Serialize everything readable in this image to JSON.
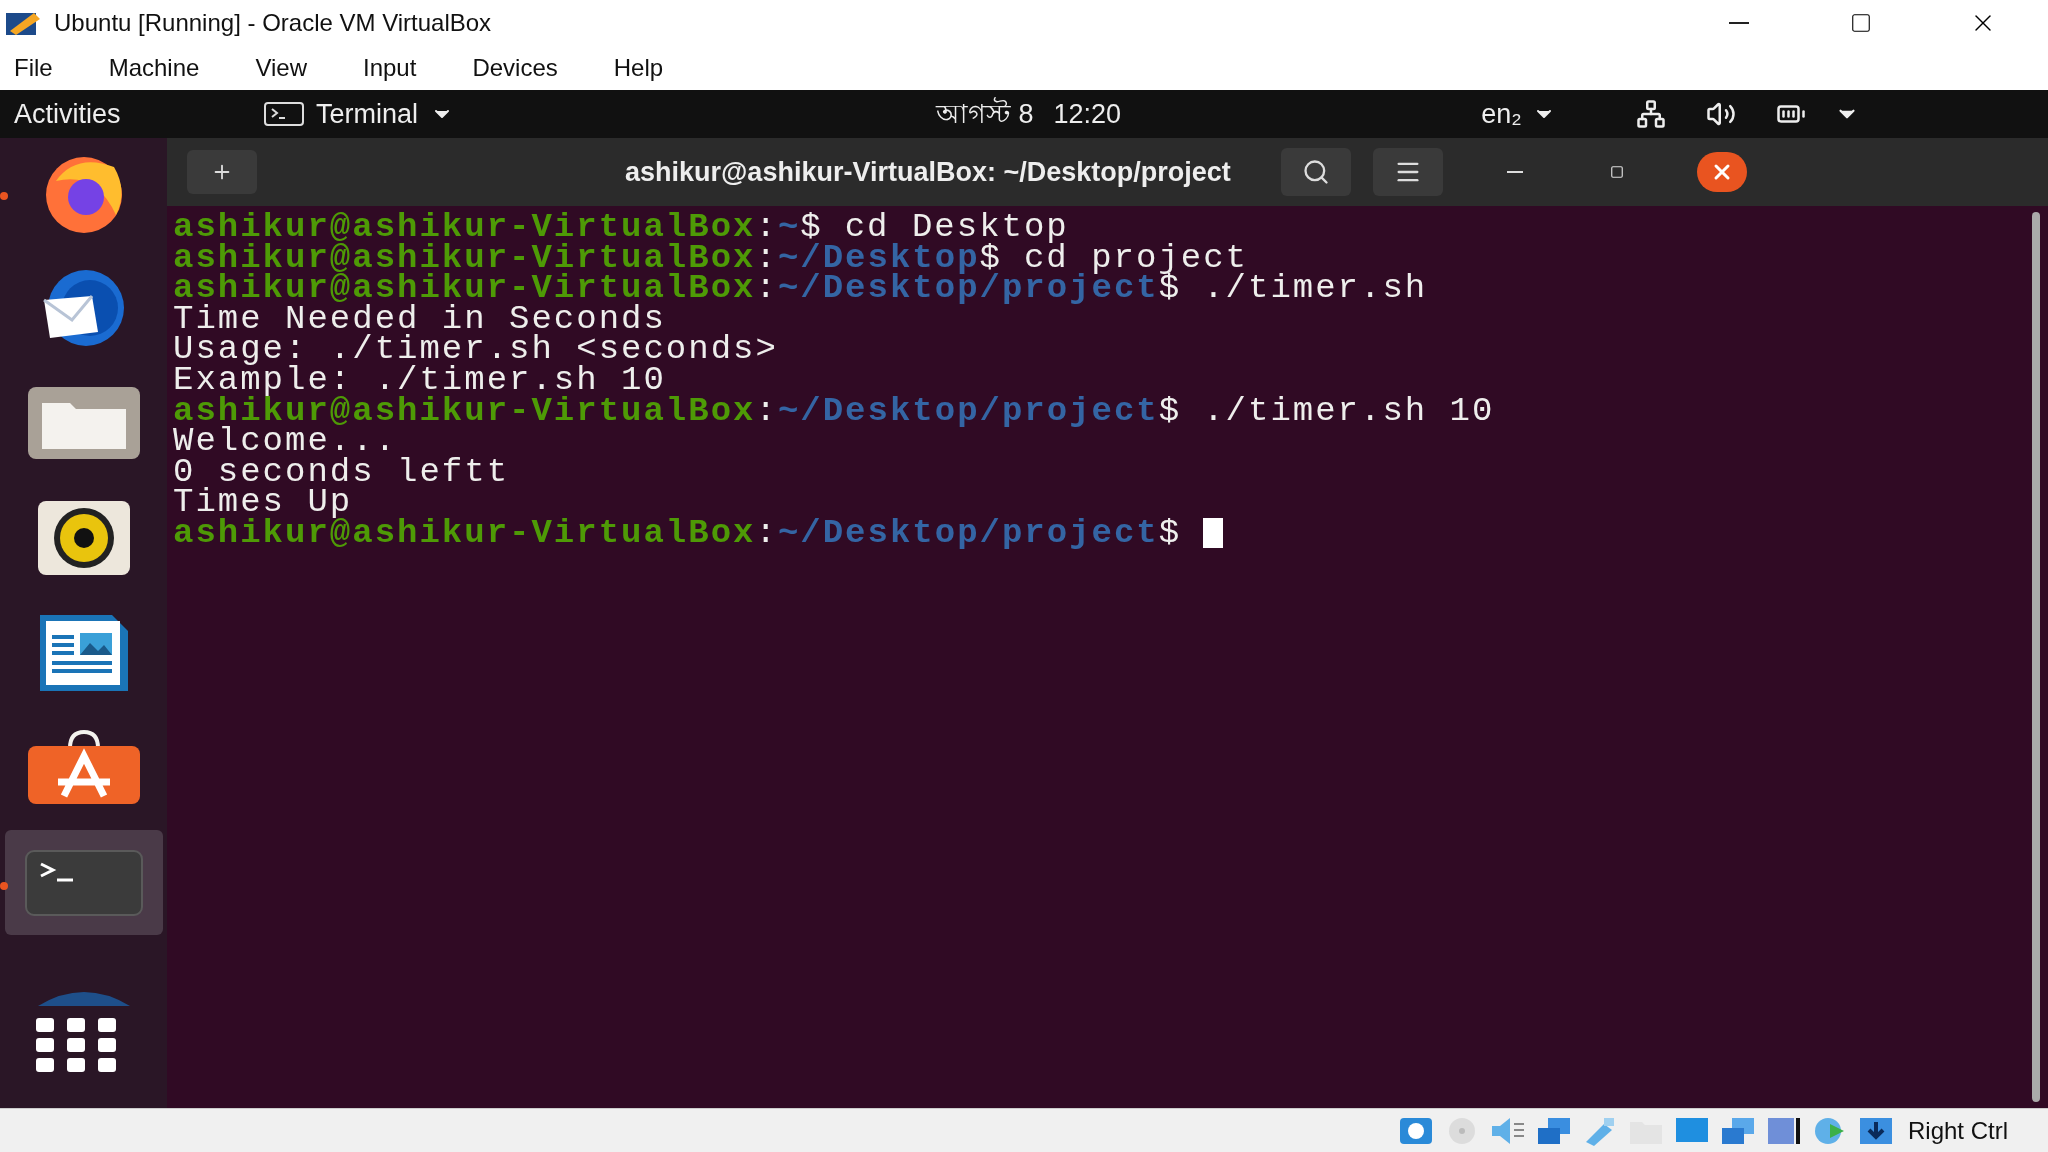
{
  "window": {
    "title": "Ubuntu [Running] - Oracle VM VirtualBox"
  },
  "menu": [
    "File",
    "Machine",
    "View",
    "Input",
    "Devices",
    "Help"
  ],
  "top_bar": {
    "activities": "Activities",
    "app": "Terminal",
    "date": "আগস্ট 8",
    "time": "12:20",
    "input_source": "en₂"
  },
  "dock": {
    "items": [
      {
        "kind": "browser",
        "running": true,
        "selected": false
      },
      {
        "kind": "mail",
        "running": false,
        "selected": false
      },
      {
        "kind": "files",
        "running": false,
        "selected": false
      },
      {
        "kind": "music",
        "running": false,
        "selected": false
      },
      {
        "kind": "writer",
        "running": false,
        "selected": false
      },
      {
        "kind": "store",
        "running": false,
        "selected": false
      },
      {
        "kind": "terminal",
        "running": true,
        "selected": true
      },
      {
        "kind": "partial",
        "running": false,
        "selected": false
      }
    ]
  },
  "terminal": {
    "title": "ashikur@ashikur-VirtualBox: ~/Desktop/project",
    "lines": [
      {
        "kind": "prompt",
        "user": "ashikur@ashikur-VirtualBox",
        "separator": ":",
        "path": "~",
        "symbol": "$",
        "command": "cd Desktop"
      },
      {
        "kind": "prompt",
        "user": "ashikur@ashikur-VirtualBox",
        "separator": ":",
        "path": "~/Desktop",
        "symbol": "$",
        "command": "cd project"
      },
      {
        "kind": "prompt",
        "user": "ashikur@ashikur-VirtualBox",
        "separator": ":",
        "path": "~/Desktop/project",
        "symbol": "$",
        "command": "./timer.sh"
      },
      {
        "kind": "output",
        "text": "Time Needed in Seconds"
      },
      {
        "kind": "output",
        "text": "Usage: ./timer.sh <seconds>"
      },
      {
        "kind": "output",
        "text": "Example: ./timer.sh 10"
      },
      {
        "kind": "prompt",
        "user": "ashikur@ashikur-VirtualBox",
        "separator": ":",
        "path": "~/Desktop/project",
        "symbol": "$",
        "command": "./timer.sh 10"
      },
      {
        "kind": "output",
        "text": "Welcome..."
      },
      {
        "kind": "output",
        "text": "0 seconds leftt"
      },
      {
        "kind": "output",
        "text": "Times Up"
      },
      {
        "kind": "prompt",
        "user": "ashikur@ashikur-VirtualBox",
        "separator": ":",
        "path": "~/Desktop/project",
        "symbol": "$",
        "cursor": true
      }
    ]
  },
  "status_bar": {
    "host_key": "Right Ctrl"
  }
}
